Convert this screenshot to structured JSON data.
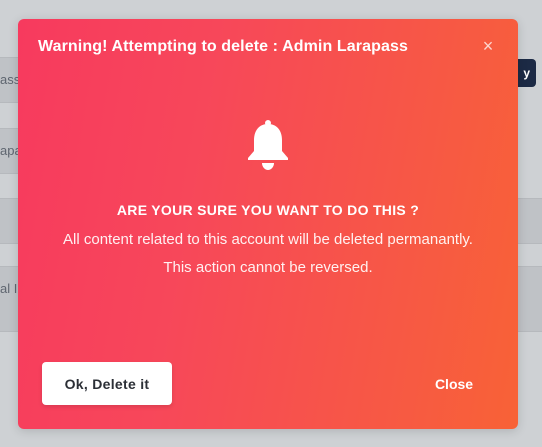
{
  "background": {
    "field_1_text": "ass.",
    "field_2_text": "apas",
    "field_3_text": "",
    "field_4_text": "al In",
    "button_text": "y"
  },
  "modal": {
    "title": "Warning! Attempting to delete : Admin Larapass",
    "close_icon": "×",
    "icon": "bell-icon",
    "heading": "ARE YOUR SURE YOU WANT TO DO THIS ?",
    "message_line_1": "All content related to this account will be deleted permanantly.",
    "message_line_2": "This action cannot be reversed.",
    "confirm_label": "Ok, Delete it",
    "close_label": "Close",
    "colors": {
      "gradient_start": "#f73a5e",
      "gradient_end": "#f86236",
      "text": "#ffffff"
    }
  }
}
